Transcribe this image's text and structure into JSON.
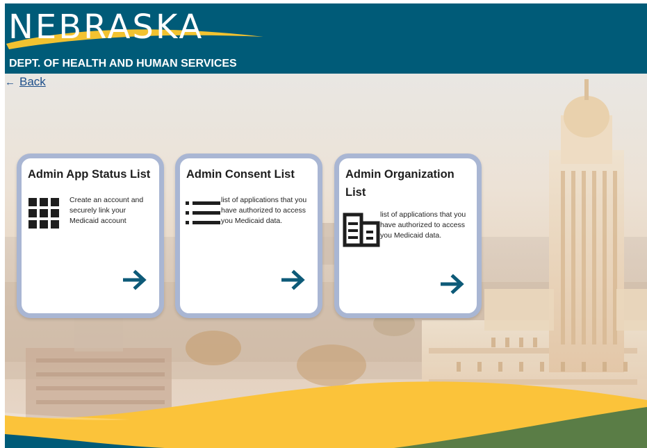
{
  "header": {
    "logo_text": "NEBRASKA",
    "department": "DEPT. OF HEALTH AND HUMAN SERVICES"
  },
  "nav": {
    "back_label": "Back",
    "back_arrow": "←"
  },
  "cards": [
    {
      "title": "Admin App Status List",
      "description": "Create an account and securely link your Medicaid account",
      "icon": "grid-icon"
    },
    {
      "title": "Admin Consent List",
      "description": "list of applications that you have authorized to access you Medicaid data.",
      "icon": "list-icon"
    },
    {
      "title": "Admin Organization List",
      "description": "list of applications that you have authorized to access you Medicaid data.",
      "icon": "building-icon"
    }
  ],
  "colors": {
    "header_bg": "#005b78",
    "swoosh": "#f2c230",
    "card_border": "#a9b6d3",
    "arrow": "#0d5a78",
    "wave_yellow": "#fbc33a",
    "wave_green": "#5a7d46"
  }
}
